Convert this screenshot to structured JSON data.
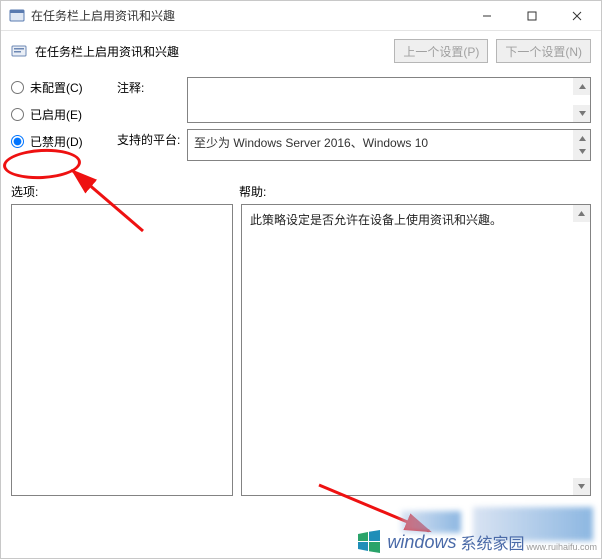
{
  "titlebar": {
    "title": "在任务栏上启用资讯和兴趣"
  },
  "toolbar": {
    "title": "在任务栏上启用资讯和兴趣",
    "prev_label": "上一个设置(P)",
    "next_label": "下一个设置(N)"
  },
  "radios": {
    "not_configured": "未配置(C)",
    "enabled": "已启用(E)",
    "disabled": "已禁用(D)",
    "selected": "disabled"
  },
  "fields": {
    "comment_label": "注释:",
    "comment_value": "",
    "platform_label": "支持的平台:",
    "platform_value": "至少为 Windows Server 2016、Windows 10"
  },
  "sections": {
    "options_label": "选项:",
    "help_label": "帮助:"
  },
  "help": {
    "text": "此策略设定是否允许在设备上使用资讯和兴趣。"
  },
  "watermark": {
    "brand": "windows",
    "suffix": "系统家园",
    "url": "www.ruihaifu.com"
  }
}
